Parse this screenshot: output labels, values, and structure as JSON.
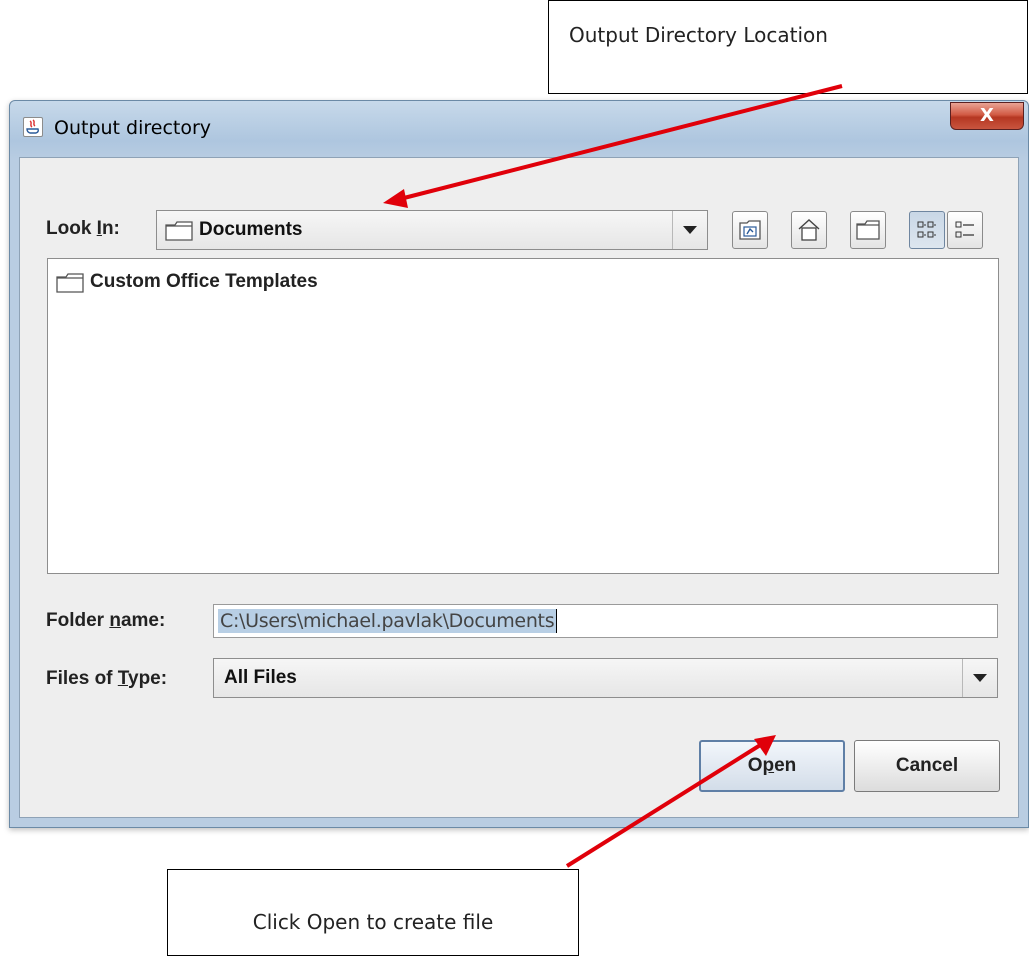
{
  "annotations": {
    "top": "Output Directory Location",
    "bottom": "Click Open to create file"
  },
  "window": {
    "title": "Output directory",
    "close_label": "X"
  },
  "dialog": {
    "look_in_label_pre": "Look ",
    "look_in_label_mnemonic": "I",
    "look_in_label_post": "n:",
    "look_in_value": "Documents",
    "files": [
      "Custom Office Templates"
    ],
    "folder_name_label_pre": "Folder ",
    "folder_name_label_mnemonic": "n",
    "folder_name_label_post": "ame:",
    "folder_name_value": "C:\\Users\\michael.pavlak\\Documents",
    "files_of_type_label_pre": "Files of ",
    "files_of_type_label_mnemonic": "T",
    "files_of_type_label_post": "ype:",
    "files_of_type_value": "All Files",
    "open_label_pre": "O",
    "open_label_mnemonic": "p",
    "open_label_post": "en",
    "cancel_label": "Cancel"
  },
  "colors": {
    "arrow": "#e0000a",
    "title_bar": "#b9cde2",
    "close_button": "#c9553f",
    "selection": "#b8cfe5"
  }
}
